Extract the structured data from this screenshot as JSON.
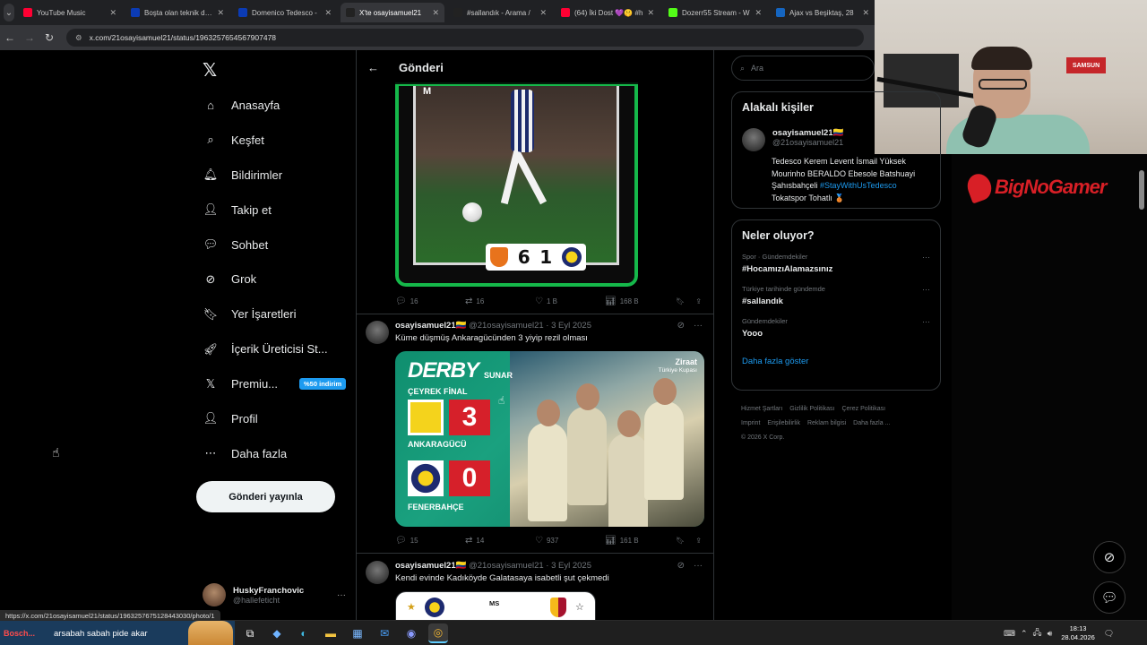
{
  "browser": {
    "tabs": [
      {
        "label": "YouTube Music",
        "color": "#ff0033",
        "active": false
      },
      {
        "label": "Boşta olan teknik dire",
        "color": "#0b3bb5",
        "active": false
      },
      {
        "label": "Domenico Tedesco -",
        "color": "#0b3bb5",
        "active": false
      },
      {
        "label": "X'te osayisamuel21",
        "color": "#222222",
        "active": true
      },
      {
        "label": "#sallandık - Arama /",
        "color": "#222222",
        "active": false
      },
      {
        "label": "(64) İki Dost 💜🤫 #h",
        "color": "#ff0033",
        "active": false
      },
      {
        "label": "Dozerr55 Stream - W",
        "color": "#53fc18",
        "active": false
      },
      {
        "label": "Ajax vs Beşiktaş, 28",
        "color": "#1565c0",
        "active": false
      }
    ],
    "url": "x.com/21osayisamuel21/status/1963257654567907478"
  },
  "webcam": {
    "sign_text": "SAMSUN"
  },
  "nav": {
    "logo": "𝕏",
    "items": [
      {
        "label": "Anasayfa",
        "icon": "home-icon",
        "glyph": "⌂"
      },
      {
        "label": "Keşfet",
        "icon": "search-icon",
        "glyph": "⌕"
      },
      {
        "label": "Bildirimler",
        "icon": "bell-icon",
        "glyph": "🔔︎"
      },
      {
        "label": "Takip et",
        "icon": "follow-icon",
        "glyph": "👤︎"
      },
      {
        "label": "Sohbet",
        "icon": "chat-icon",
        "glyph": "💬︎"
      },
      {
        "label": "Grok",
        "icon": "grok-icon",
        "glyph": "⊘"
      },
      {
        "label": "Yer İşaretleri",
        "icon": "bookmark-icon",
        "glyph": "🔖︎"
      },
      {
        "label": "İçerik Üreticisi St...",
        "icon": "rocket-icon",
        "glyph": "🚀︎"
      },
      {
        "label": "Premiu...",
        "icon": "x-premium-icon",
        "glyph": "𝕏",
        "badge": "%50 indirim"
      },
      {
        "label": "Profil",
        "icon": "profile-icon",
        "glyph": "👤︎"
      },
      {
        "label": "Daha fazla",
        "icon": "more-circle-icon",
        "glyph": "⋯"
      }
    ],
    "post_button": "Gönderi yayınla",
    "account": {
      "name": "HuskyFranchovic",
      "handle": "@hallefeticht"
    }
  },
  "timeline": {
    "header": "Gönderi",
    "post1": {
      "score_home": "6",
      "score_away": "1",
      "vertical_text": "M",
      "replies": "16",
      "reposts": "16",
      "likes": "1 B",
      "views": "168 B"
    },
    "post2": {
      "name": "osayisamuel21🇨🇴",
      "handle": "@21osayisamuel21 · 3 Eyl 2025",
      "text": "Küme düşmüş Ankaragücünden 3 yiyip rezil olması",
      "media": {
        "title": "DERBY",
        "sponsor": "SUNAR",
        "round": "ÇEYREK FİNAL",
        "home_team": "ANKARAGÜCÜ",
        "home_score": "3",
        "away_team": "FENERBAHÇE",
        "away_score": "0",
        "brand": "Ziraat",
        "cup": "Türkiye Kupası"
      },
      "replies": "15",
      "reposts": "14",
      "likes": "937",
      "views": "161 B"
    },
    "post3": {
      "name": "osayisamuel21🇨🇴",
      "handle": "@21osayisamuel21 · 3 Eyl 2025",
      "text": "Kendi evinde Kadıköyde Galatasaya isabetli şut çekmedi",
      "media_label": "MS"
    }
  },
  "sidebar": {
    "search_placeholder": "Ara",
    "related": {
      "title": "Alakalı kişiler",
      "name": "osayisamuel21🇨🇴",
      "handle": "@21osayisamuel21",
      "bio_1": "Tedesco Kerem Levent İsmail Yüksek",
      "bio_2": "Mourinho BERALDO Ebesole Batshuayi",
      "bio_3": "Şahısbahçeli ",
      "bio_tag": "#StayWithUsTedesco",
      "bio_4": "Tokatspor Tohatlı 🥉"
    },
    "trends": {
      "title": "Neler oluyor?",
      "items": [
        {
          "category": "Spor · Gündemdekiler",
          "name": "#HocamızıAlamazsınız"
        },
        {
          "category": "Türkiye tarihinde gündemde",
          "name": "#sallandık"
        },
        {
          "category": "Gündemdekiler",
          "name": "Yooo"
        }
      ],
      "show_more": "Daha fazla göster"
    },
    "footer": [
      "Hizmet Şartları",
      "Gizlilik Politikası",
      "Çerez Politikası",
      "Imprint",
      "Erişilebilirlik",
      "Reklam bilgisi",
      "Daha fazla ...",
      "© 2026 X Corp."
    ]
  },
  "overlay": {
    "brand": "BigNoGamer"
  },
  "statusbar": {
    "link": "https://x.com/21osayisamuel21/status/1963257675128443030/photo/1"
  },
  "taskbar": {
    "ticker_prefix": "Bosch...",
    "ticker_text": "arsabah sabah pide akar",
    "time": "18:13",
    "date": "28.04.2026"
  }
}
